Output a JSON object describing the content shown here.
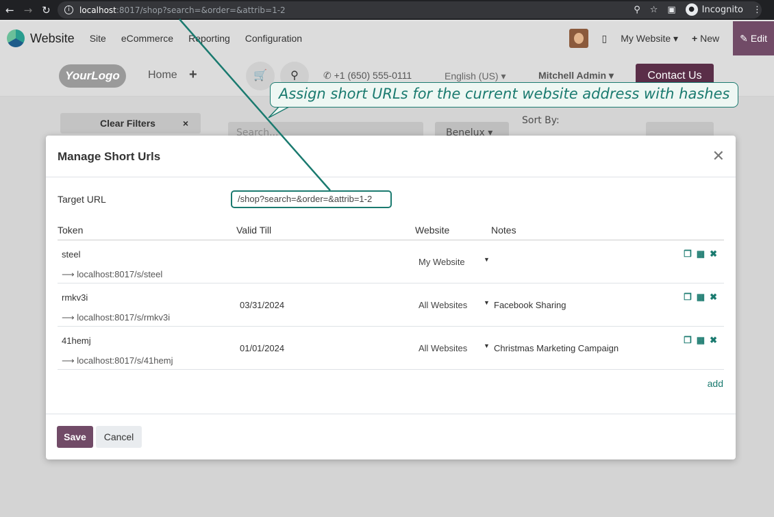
{
  "browser": {
    "url_host": "localhost",
    "url_path": ":8017/shop?search=&order=&attrib=1-2",
    "incognito_label": "Incognito"
  },
  "odoo": {
    "app_name": "Website",
    "menu": [
      "Site",
      "eCommerce",
      "Reporting",
      "Configuration"
    ],
    "website_switch": "My Website",
    "new_label": "New",
    "edit_label": "Edit"
  },
  "site": {
    "logo": "YourLogo",
    "home": "Home",
    "phone": "+1 (650) 555-0111",
    "language": "English (US)",
    "user": "Mitchell Admin",
    "contact": "Contact Us",
    "clear_filters": "Clear Filters",
    "search_placeholder": "Search...",
    "pricelist": "Benelux",
    "sort_by": "Sort By:"
  },
  "modal": {
    "title": "Manage Short Urls",
    "target_label": "Target URL",
    "target_value": "/shop?search=&order=&attrib=1-2",
    "columns": [
      "Token",
      "Valid Till",
      "Website",
      "Notes"
    ],
    "rows": [
      {
        "token": "steel",
        "short": "localhost:8017/s/steel",
        "valid": "",
        "website": "My Website",
        "notes": ""
      },
      {
        "token": "rmkv3i",
        "short": "localhost:8017/s/rmkv3i",
        "valid": "03/31/2024",
        "website": "All Websites",
        "notes": "Facebook Sharing"
      },
      {
        "token": "41hemj",
        "short": "localhost:8017/s/41hemj",
        "valid": "01/01/2024",
        "website": "All Websites",
        "notes": "Christmas Marketing Campaign"
      }
    ],
    "add_label": "add",
    "save_label": "Save",
    "cancel_label": "Cancel"
  },
  "annotation": {
    "text": "Assign short URLs for the current website address with hashes"
  },
  "colors": {
    "accent": "#1a7a6f",
    "brand": "#714b67"
  }
}
